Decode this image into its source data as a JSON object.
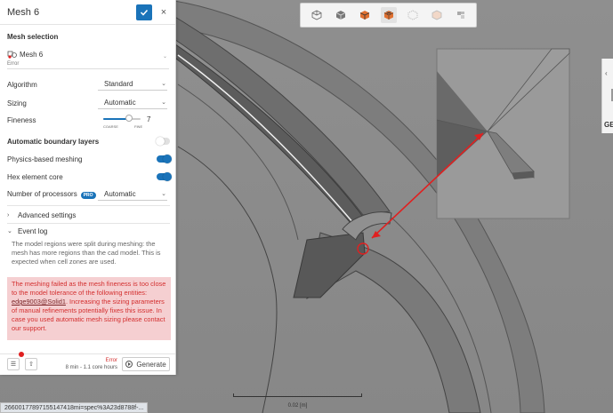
{
  "panel": {
    "title": "Mesh 6",
    "confirm_icon": "check-icon",
    "close_icon": "close-icon",
    "mesh_selection": {
      "label": "Mesh selection",
      "name": "Mesh 6",
      "status": "Error"
    },
    "settings": {
      "algorithm": {
        "label": "Algorithm",
        "value": "Standard"
      },
      "sizing": {
        "label": "Sizing",
        "value": "Automatic"
      },
      "fineness": {
        "label": "Fineness",
        "value": "7",
        "coarse": "COARSE",
        "fine": "FINE",
        "level": 7,
        "max": 10
      },
      "automatic_boundary_layers": {
        "label": "Automatic boundary layers",
        "enabled": false
      },
      "physics_based_meshing": {
        "label": "Physics-based meshing",
        "enabled": true
      },
      "hex_element_core": {
        "label": "Hex element core",
        "enabled": true
      },
      "number_of_processors": {
        "label": "Number of processors",
        "badge": "PRO",
        "value": "Automatic"
      }
    },
    "advanced_settings_label": "Advanced settings",
    "event_log_label": "Event log",
    "info_message": "The model regions were split during meshing: the mesh has more regions than the cad model. This is expected when cell zones are used.",
    "error_message": {
      "before": "The meshing failed as the mesh fineness is too close to the model tolerance of the following entities: ",
      "link": "edge9003@Solid1",
      "after": ". Increasing the sizing parameters of manual refinements potentially fixes this issue. In case you used automatic mesh sizing please contact our support."
    },
    "footer": {
      "status": "Error",
      "time": "8 min - 1.1 core hours",
      "generate_label": "Generate"
    }
  },
  "viewport": {
    "scale_label": "0.02 [m]",
    "status_url": "2660017789715514​7418mi=spec%3A23d8788f-...",
    "right_panel_label": "GE"
  },
  "colors": {
    "accent": "#1a73b9",
    "error": "#d32f2f",
    "error_bg": "#f5cfd1",
    "highlight": "#e02020"
  }
}
